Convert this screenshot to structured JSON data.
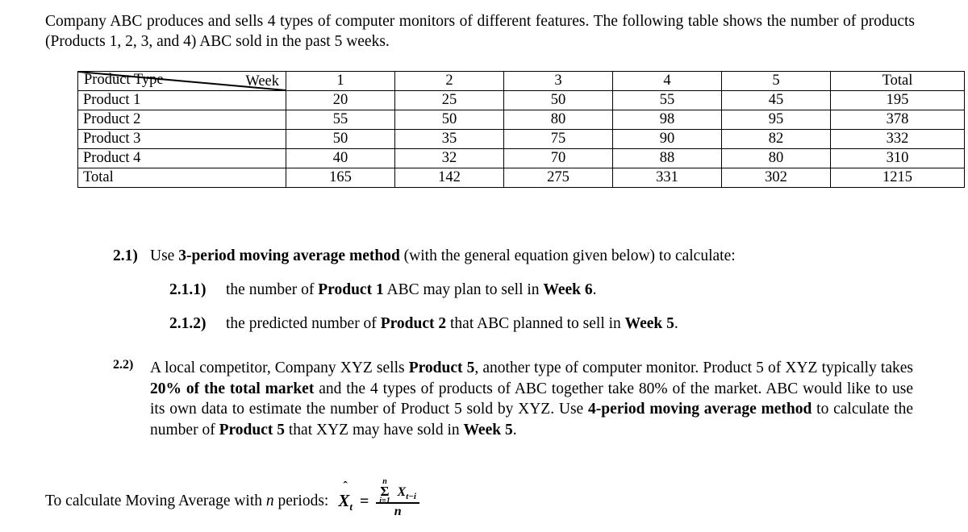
{
  "document": {
    "intro": {
      "text": "Company ABC produces and sells 4 types of computer monitors of different features. The following table shows the number of products (Products 1, 2, 3, and 4) ABC sold in the past 5 weeks."
    },
    "table": {
      "corner_top_label": "Week",
      "corner_bottom_label": "Product Type",
      "column_headers": [
        "1",
        "2",
        "3",
        "4",
        "5",
        "Total"
      ],
      "rows": [
        {
          "label": "Product 1",
          "values": [
            "20",
            "25",
            "50",
            "55",
            "45"
          ],
          "total": "195"
        },
        {
          "label": "Product 2",
          "values": [
            "55",
            "50",
            "80",
            "98",
            "95"
          ],
          "total": "378"
        },
        {
          "label": "Product 3",
          "values": [
            "50",
            "35",
            "75",
            "90",
            "82"
          ],
          "total": "332"
        },
        {
          "label": "Product 4",
          "values": [
            "40",
            "32",
            "70",
            "88",
            "80"
          ],
          "total": "310"
        },
        {
          "label": "Total",
          "values": [
            "165",
            "142",
            "275",
            "331",
            "302"
          ],
          "total": "1215"
        }
      ]
    },
    "questions": [
      {
        "number": "2.1)",
        "text_before": "Use ",
        "bold_1": "3-period moving average method",
        "text_after": " (with the general equation given below) to calculate:",
        "subitems": [
          {
            "number": "2.1.1)",
            "seg_1": "the number of ",
            "bold_1": "Product 1",
            "seg_2": " ABC may plan to sell in ",
            "bold_2": "Week 6",
            "seg_3": "."
          },
          {
            "number": "2.1.2)",
            "seg_1": "the predicted number of ",
            "bold_1": "Product 2",
            "seg_2": " that ABC planned to sell in ",
            "bold_2": "Week 5",
            "seg_3": "."
          }
        ]
      },
      {
        "number": "2.2)",
        "seg_1": "A local competitor, Company XYZ sells ",
        "bold_1": "Product 5",
        "seg_2": ", another type of computer monitor. Product 5 of XYZ typically takes ",
        "bold_2": "20% of the total market",
        "seg_3": " and the 4 types of products of ABC together take 80% of the market. ABC would like to use its own data to estimate the number of Product 5 sold by XYZ. Use ",
        "bold_3": "4-period moving average method",
        "seg_4": " to calculate the number of ",
        "bold_4": "Product 5",
        "seg_5": " that XYZ may have sold in ",
        "bold_5": "Week 5",
        "seg_6": "."
      }
    ],
    "formula": {
      "label": "To calculate Moving Average with",
      "label_var": "n",
      "label_tail": "periods:",
      "lhs_symbol": "X",
      "lhs_hat": "̂",
      "lhs_subscript": "t",
      "equals": "=",
      "sigma_symbol": "Σ",
      "sigma_lower": "i=1",
      "sigma_upper": "n",
      "numerator_term": "X",
      "numerator_subscript": "t−i",
      "denominator": "n"
    }
  }
}
